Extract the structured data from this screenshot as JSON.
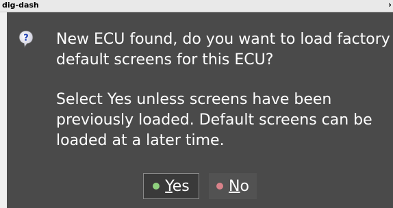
{
  "window": {
    "title": "dig-dash",
    "corner_glyph": "›"
  },
  "dialog": {
    "icon": "question-icon",
    "message_line1": "New ECU found, do you want to load factory default screens for this ECU?",
    "message_line2": "Select Yes unless screens have been previously loaded.  Default screens can be loaded at a later time.",
    "buttons": {
      "yes": {
        "mnemonic": "Y",
        "rest": "es",
        "indicator_color": "#8fd17e"
      },
      "no": {
        "mnemonic": "N",
        "rest": "o",
        "indicator_color": "#d9828a"
      }
    }
  },
  "colors": {
    "dialog_background": "#4a4a4a",
    "text": "#ffffff",
    "icon_blue": "#1f3fb3"
  }
}
